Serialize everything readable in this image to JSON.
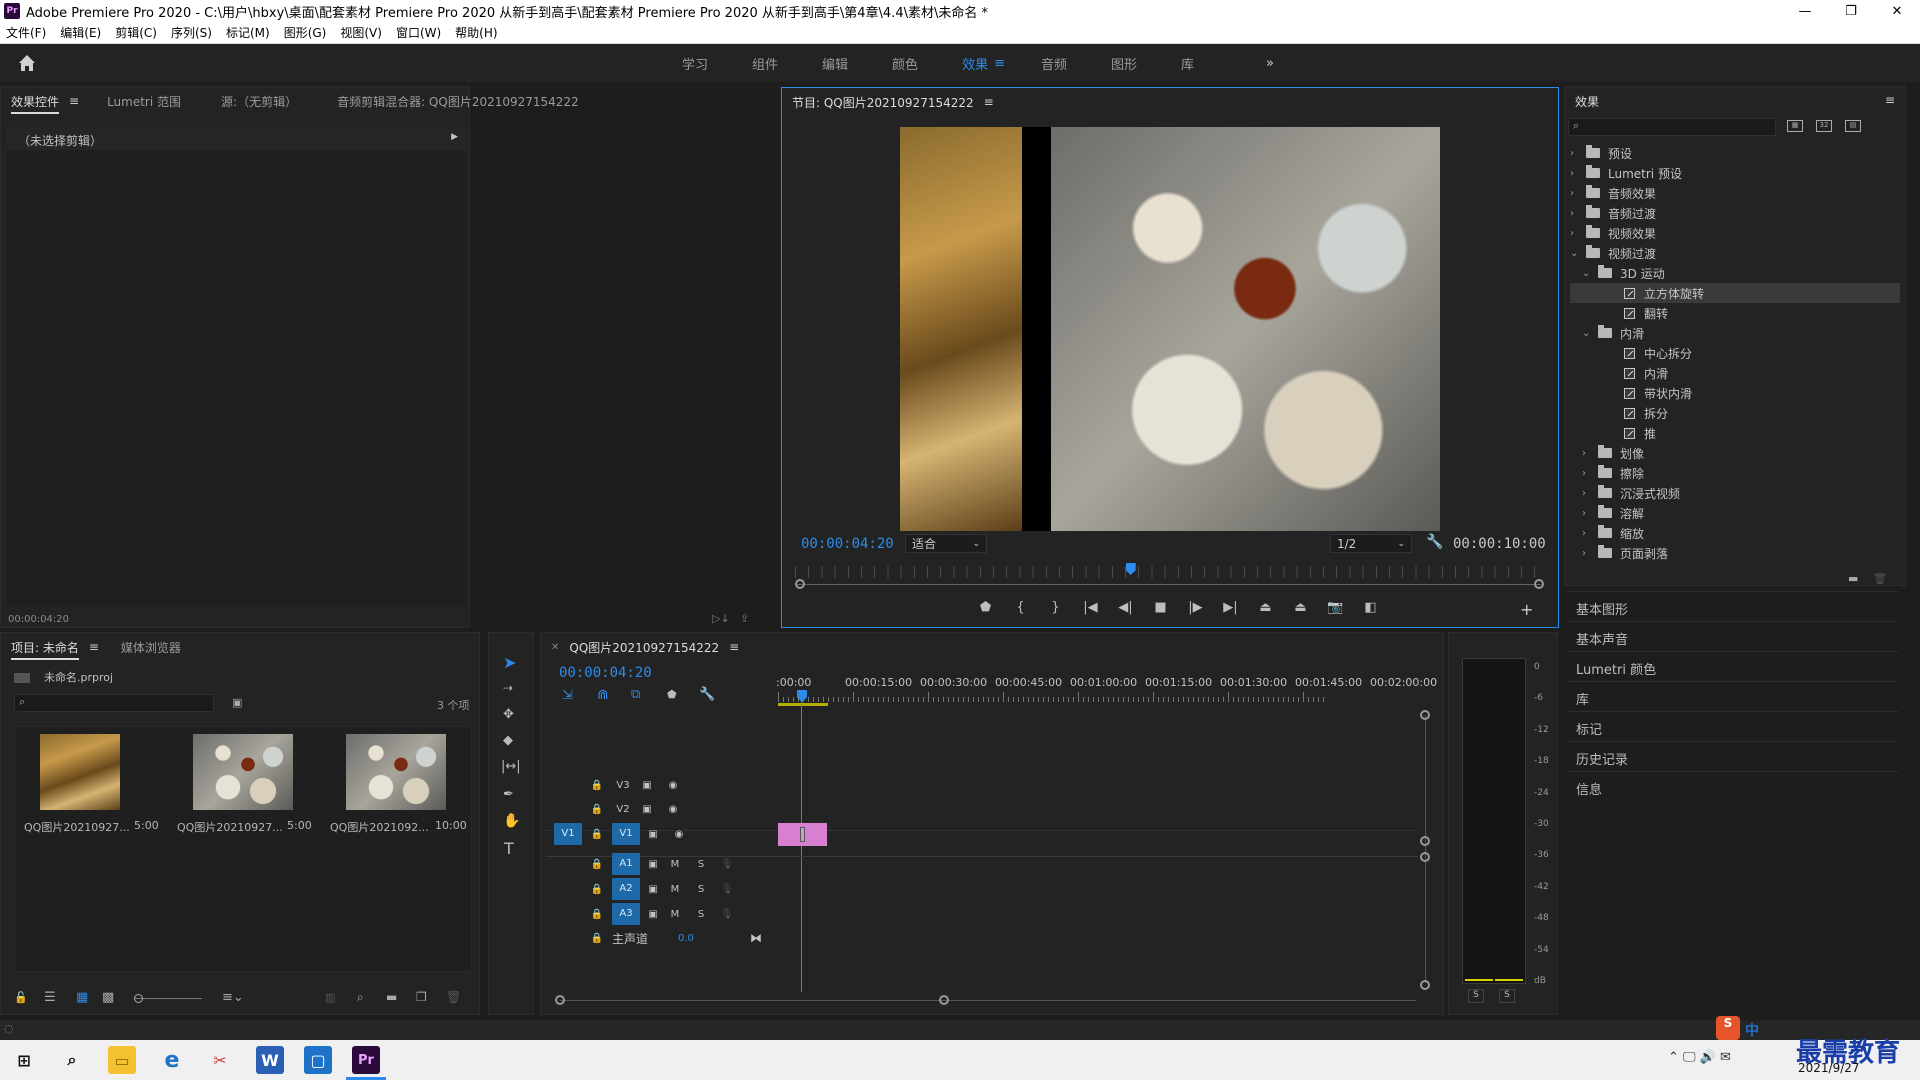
{
  "titlebar": {
    "title": "Adobe Premiere Pro 2020 - C:\\用户\\hbxy\\桌面\\配套素材 Premiere Pro 2020 从新手到高手\\配套素材 Premiere Pro 2020 从新手到高手\\第4章\\4.4\\素材\\未命名 *",
    "logo": "Pr",
    "minimize": "—",
    "restore": "❐",
    "close": "✕"
  },
  "menubar": [
    "文件(F)",
    "编辑(E)",
    "剪辑(C)",
    "序列(S)",
    "标记(M)",
    "图形(G)",
    "视图(V)",
    "窗口(W)",
    "帮助(H)"
  ],
  "workspaces": {
    "tabs": [
      "学习",
      "组件",
      "编辑",
      "颜色",
      "效果",
      "音频",
      "图形",
      "库"
    ],
    "active": "效果",
    "more": "»"
  },
  "effect_controls": {
    "tabs": [
      "效果控件",
      "Lumetri 范围",
      "源:（无剪辑）",
      "音频剪辑混合器: QQ图片20210927154222"
    ],
    "no_clip": "（未选择剪辑）",
    "timecode": "00:00:04:20"
  },
  "program": {
    "title": "节目: QQ图片20210927154222",
    "timecode": "00:00:04:20",
    "fit": "适合",
    "resolution": "1/2",
    "duration": "00:00:10:00",
    "playhead_fraction": 0.45
  },
  "effects_panel": {
    "title": "效果",
    "tree": [
      {
        "label": "预设",
        "level": 0,
        "kind": "folder-special",
        "open": false
      },
      {
        "label": "Lumetri 预设",
        "level": 0,
        "kind": "folder-special",
        "open": false
      },
      {
        "label": "音频效果",
        "level": 0,
        "kind": "folder",
        "open": false
      },
      {
        "label": "音频过渡",
        "level": 0,
        "kind": "folder",
        "open": false
      },
      {
        "label": "视频效果",
        "level": 0,
        "kind": "folder",
        "open": false
      },
      {
        "label": "视频过渡",
        "level": 0,
        "kind": "folder",
        "open": true
      },
      {
        "label": "3D 运动",
        "level": 1,
        "kind": "folder",
        "open": true
      },
      {
        "label": "立方体旋转",
        "level": 2,
        "kind": "effect",
        "selected": true
      },
      {
        "label": "翻转",
        "level": 2,
        "kind": "effect"
      },
      {
        "label": "内滑",
        "level": 1,
        "kind": "folder",
        "open": true
      },
      {
        "label": "中心拆分",
        "level": 2,
        "kind": "effect"
      },
      {
        "label": "内滑",
        "level": 2,
        "kind": "effect"
      },
      {
        "label": "带状内滑",
        "level": 2,
        "kind": "effect"
      },
      {
        "label": "拆分",
        "level": 2,
        "kind": "effect"
      },
      {
        "label": "推",
        "level": 2,
        "kind": "effect"
      },
      {
        "label": "划像",
        "level": 1,
        "kind": "folder",
        "open": false
      },
      {
        "label": "擦除",
        "level": 1,
        "kind": "folder",
        "open": false
      },
      {
        "label": "沉浸式视频",
        "level": 1,
        "kind": "folder",
        "open": false
      },
      {
        "label": "溶解",
        "level": 1,
        "kind": "folder",
        "open": false
      },
      {
        "label": "缩放",
        "level": 1,
        "kind": "folder",
        "open": false
      },
      {
        "label": "页面剥落",
        "level": 1,
        "kind": "folder",
        "open": false
      }
    ],
    "side_panels": [
      "基本图形",
      "基本声音",
      "Lumetri 颜色",
      "库",
      "标记",
      "历史记录",
      "信息"
    ]
  },
  "project": {
    "tabs": [
      "项目: 未命名",
      "媒体浏览器"
    ],
    "file": "未命名.prproj",
    "count": "3 个项",
    "items": [
      {
        "name": "QQ图片20210927...",
        "duration": "5:00"
      },
      {
        "name": "QQ图片20210927...",
        "duration": "5:00"
      },
      {
        "name": "QQ图片2021092...",
        "duration": "10:00"
      }
    ]
  },
  "timeline": {
    "sequence": "QQ图片20210927154222",
    "timecode": "00:00:04:20",
    "ruler": [
      ":00:00",
      "00:00:15:00",
      "00:00:30:00",
      "00:00:45:00",
      "00:01:00:00",
      "00:01:15:00",
      "00:01:30:00",
      "00:01:45:00",
      "00:02:00:00"
    ],
    "video_tracks": [
      "V3",
      "V2",
      "V1"
    ],
    "audio_tracks": [
      "A1",
      "A2",
      "A3"
    ],
    "source_patch": "V1",
    "master": "主声道",
    "master_value": "0.0",
    "m_label": "M",
    "s_label": "S"
  },
  "meter": {
    "scale": [
      "0",
      "-6",
      "-12",
      "-18",
      "-24",
      "-30",
      "-36",
      "-42",
      "-48",
      "-54",
      "dB"
    ],
    "solo": [
      "S",
      "S"
    ]
  },
  "taskbar": {
    "date": "2021/9/27",
    "watermark": "最需教育",
    "ime": "中"
  },
  "colors": {
    "accent": "#2d8ceb",
    "clip": "#d77fd1",
    "panel": "#232323"
  }
}
